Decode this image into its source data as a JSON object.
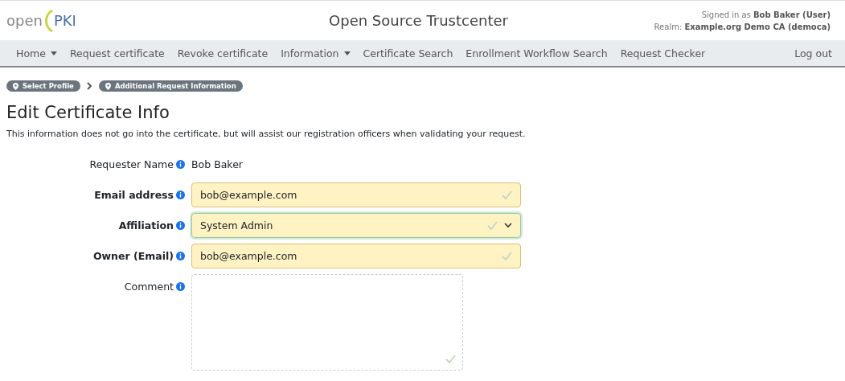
{
  "header": {
    "logo": {
      "left": "open",
      "right": "PKI"
    },
    "title": "Open Source Trustcenter",
    "signed_in": "Signed in as **Bob Baker (User)**",
    "realm": "Realm: **Example.org Demo CA (democa)**"
  },
  "nav": {
    "items": [
      {
        "label": "Home",
        "dropdown": true
      },
      {
        "label": "Request certificate",
        "dropdown": false
      },
      {
        "label": "Revoke certificate",
        "dropdown": false
      },
      {
        "label": "Information",
        "dropdown": true
      },
      {
        "label": "Certificate Search",
        "dropdown": false
      },
      {
        "label": "Enrollment Workflow Search",
        "dropdown": false
      },
      {
        "label": "Request Checker",
        "dropdown": false
      }
    ],
    "logout": "Log out"
  },
  "breadcrumbs": [
    "Select Profile",
    "Additional Request Information"
  ],
  "page": {
    "title": "Edit Certificate Info",
    "description": "This information does not go into the certificate, but will assist our registration officers when validating your request."
  },
  "fields": [
    {
      "kind": "static",
      "label": "Requester Name",
      "required": false,
      "value": "Bob Baker"
    },
    {
      "kind": "text",
      "label": "Email address",
      "required": true,
      "value": "bob@example.com",
      "focused": false
    },
    {
      "kind": "select",
      "label": "Affiliation",
      "required": true,
      "value": "System Admin",
      "focused": true
    },
    {
      "kind": "text",
      "label": "Owner (Email)",
      "required": true,
      "value": "bob@example.com",
      "focused": false
    },
    {
      "kind": "textarea",
      "label": "Comment",
      "required": false
    }
  ]
}
